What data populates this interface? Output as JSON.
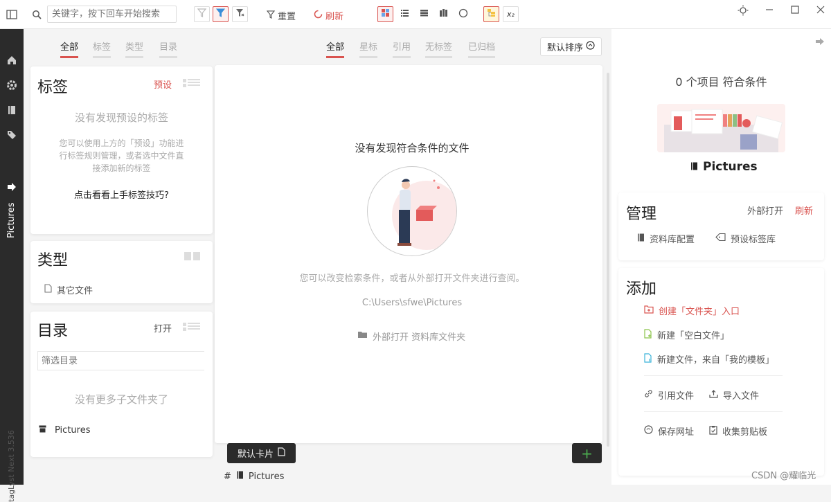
{
  "toolbar": {
    "search_placeholder": "关键字，按下回车开始搜索",
    "reset_label": "重置",
    "refresh_label": "刷新",
    "x2_label": "x₂"
  },
  "leftbar": {
    "library_name": "Pictures",
    "version": "tagLyst Next 3.536"
  },
  "left_panel": {
    "tabs": [
      "全部",
      "标签",
      "类型",
      "目录"
    ],
    "tags_card": {
      "title": "标签",
      "preset_label": "预设",
      "empty_title": "没有发现预设的标签",
      "desc_line1": "您可以使用上方的「预设」功能进",
      "desc_line2": "行标签规则管理，或者选中文件直",
      "desc_line3": "接添加新的标签",
      "tip": "点击看看上手标签技巧?"
    },
    "type_card": {
      "title": "类型",
      "item": "其它文件"
    },
    "dir_card": {
      "title": "目录",
      "open_label": "打开",
      "filter_placeholder": "筛选目录",
      "empty": "没有更多子文件夹了",
      "item": "Pictures"
    }
  },
  "center_panel": {
    "tabs": [
      "全部",
      "星标",
      "引用",
      "无标签",
      "已归档"
    ],
    "sort_label": "默认排序",
    "empty_title": "没有发现符合条件的文件",
    "empty_desc": "您可以改变检索条件，或者从外部打开文件夹进行查阅。",
    "path": "C:\\Users\\sfwe\\Pictures",
    "open_external": "外部打开 资料库文件夹",
    "card_button": "默认卡片",
    "add_button": "+",
    "footer_hash": "#",
    "footer_name": "Pictures"
  },
  "right_panel": {
    "count_text": "0 个项目 符合条件",
    "library_name": "Pictures",
    "manage": {
      "title": "管理",
      "open_external": "外部打开",
      "refresh": "刷新",
      "config": "资料库配置",
      "preset_tags": "预设标签库"
    },
    "add": {
      "title": "添加",
      "create_folder": "创建「文件夹」入口",
      "new_blank": "新建「空白文件」",
      "new_from_template": "新建文件，来自「我的模板」",
      "ref_file": "引用文件",
      "import_file": "导入文件",
      "save_url": "保存网址",
      "clipboard": "收集剪贴板"
    }
  },
  "watermark": "CSDN @耀临光",
  "colors": {
    "accent": "#d9534f",
    "dark": "#2b2b2b",
    "green_plus": "#4caf50"
  }
}
